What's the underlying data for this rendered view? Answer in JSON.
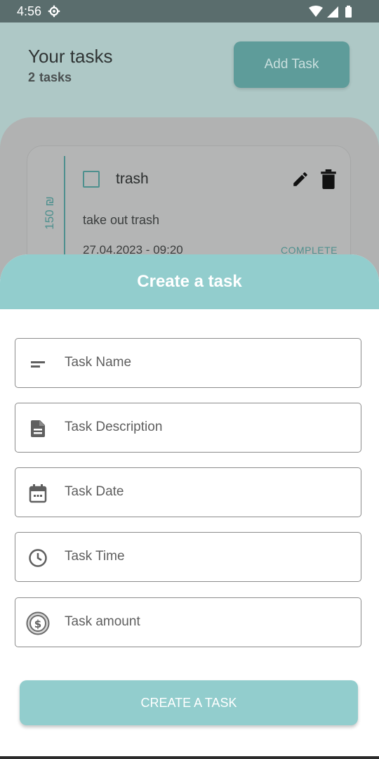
{
  "status_bar": {
    "time": "4:56"
  },
  "header": {
    "title": "Your tasks",
    "task_count": "2",
    "task_count_unit": "tasks",
    "add_task_label": "Add Task"
  },
  "task_card": {
    "amount": "150 ₪",
    "name": "trash",
    "description": "take out trash",
    "datetime": "27.04.2023  -  09:20",
    "status": "COMPLETE"
  },
  "sheet": {
    "title": "Create a task",
    "fields": [
      {
        "icon": "subject-icon",
        "placeholder": "Task Name"
      },
      {
        "icon": "description-icon",
        "placeholder": "Task Description"
      },
      {
        "icon": "calendar-icon",
        "placeholder": "Task Date"
      },
      {
        "icon": "clock-icon",
        "placeholder": "Task Time"
      },
      {
        "icon": "dollar-coin-icon",
        "placeholder": "Task amount"
      }
    ],
    "submit_label": "CREATE A TASK"
  },
  "colors": {
    "accent": "#92cdcd",
    "accent_dark": "#4e908e",
    "field_border": "#8b8b8b"
  }
}
